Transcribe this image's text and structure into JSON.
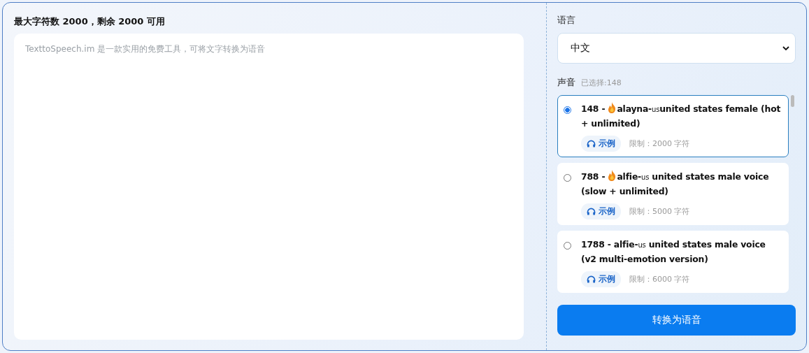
{
  "editor": {
    "counter": "最大字符数 2000，剩余 2000 可用",
    "placeholder": "TexttoSpeech.im 是一款实用的免费工具，可将文字转换为语音"
  },
  "language": {
    "label": "语言",
    "value": "中文"
  },
  "voices": {
    "label": "声音",
    "selected_note": "已选择:148",
    "items": [
      {
        "number": "148 - ",
        "hot": true,
        "name": "alayna-",
        "region": "us",
        "desc": "united states female (hot + unlimited)",
        "sample": "示例",
        "limit": "限制：2000 字符",
        "selected": true
      },
      {
        "number": "788 - ",
        "hot": true,
        "name": "alfie-",
        "region": "us",
        "desc": " united states male voice (slow + unlimited)",
        "sample": "示例",
        "limit": "限制：5000 字符",
        "selected": false
      },
      {
        "number": "1788 - ",
        "hot": false,
        "name": "alfie-",
        "region": "us",
        "desc": " united states male voice (v2 multi-emotion version)",
        "sample": "示例",
        "limit": "限制：6000 字符",
        "selected": false
      }
    ]
  },
  "convert_button": "转换为语音"
}
